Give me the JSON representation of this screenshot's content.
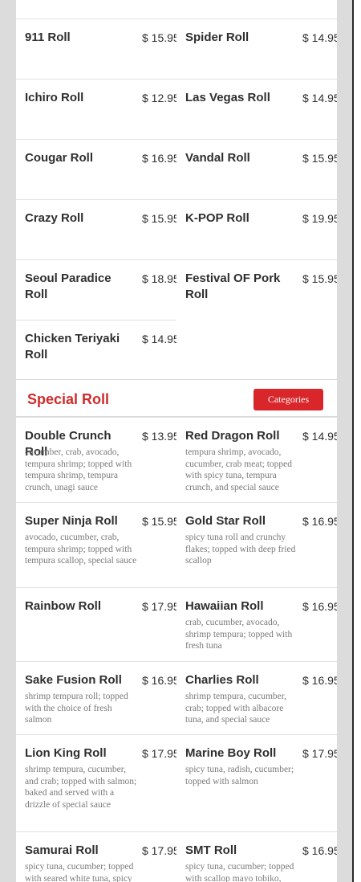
{
  "categories_button": "Categories",
  "top_rows": [
    {
      "left": {
        "name": "911 Roll",
        "price": "$ 15.95"
      },
      "right": {
        "name": "Spider Roll",
        "price": "$ 14.95"
      }
    },
    {
      "left": {
        "name": "Ichiro Roll",
        "price": "$ 12.95"
      },
      "right": {
        "name": "Las Vegas Roll",
        "price": "$ 14.95"
      }
    },
    {
      "left": {
        "name": "Cougar Roll",
        "price": "$ 16.95"
      },
      "right": {
        "name": "Vandal Roll",
        "price": "$ 15.95"
      }
    },
    {
      "left": {
        "name": "Crazy Roll",
        "price": "$ 15.95"
      },
      "right": {
        "name": "K-POP Roll",
        "price": "$ 19.95"
      }
    },
    {
      "left": {
        "name": "Seoul Paradice Roll",
        "price": "$ 18.95"
      },
      "right": {
        "name": "Festival OF Pork Roll",
        "price": "$ 15.95"
      }
    },
    {
      "left": {
        "name": "Chicken Teriyaki Roll",
        "price": "$ 14.95"
      }
    }
  ],
  "special": {
    "title": "Special Roll",
    "rows": [
      {
        "left": {
          "name": "Double Crunch Roll",
          "price": "$ 13.95",
          "desc": "cucumber, crab, avocado, tempura shrimp; topped with tempura shrimp, tempura crunch, unagi sauce"
        },
        "right": {
          "name": "Red Dragon Roll",
          "price": "$ 14.95",
          "desc": "tempura shrimp, avocado, cucumber, crab meat; topped with spicy tuna, tempura crunch, and special sauce"
        }
      },
      {
        "left": {
          "name": "Super Ninja Roll",
          "price": "$ 15.95",
          "desc": "avocado, cucumber, crab, tempura shrimp; topped with tempura scallop, special sauce"
        },
        "right": {
          "name": "Gold Star Roll",
          "price": "$ 16.95",
          "desc": "spicy tuna roll and crunchy flakes; topped with deep fried scallop"
        }
      },
      {
        "left": {
          "name": "Rainbow Roll",
          "price": "$ 17.95",
          "desc": ""
        },
        "right": {
          "name": "Hawaiian Roll",
          "price": "$ 16.95",
          "desc": "crab, cucumber, avocado, shrimp tempura; topped with fresh tuna"
        }
      },
      {
        "left": {
          "name": "Sake Fusion Roll",
          "price": "$ 16.95",
          "desc": "shrimp tempura roll; topped with the choice of fresh salmon"
        },
        "right": {
          "name": "Charlies Roll",
          "price": "$ 16.95",
          "desc": "shrimp tempura, cucumber, crab; topped with albacore tuna, and special sauce"
        }
      },
      {
        "left": {
          "name": "Lion King Roll",
          "price": "$ 17.95",
          "desc": "shrimp tempura, cucumber, and crab; topped with salmon; baked and served with a drizzle of special sauce"
        },
        "right": {
          "name": "Marine Boy Roll",
          "price": "$ 17.95",
          "desc": "spicy tuna, radish, cucumber; topped with salmon"
        }
      },
      {
        "left": {
          "name": "Samurai Roll",
          "price": "$ 17.95",
          "desc": "spicy tuna, cucumber; topped with seared white tuna, spicy"
        },
        "right": {
          "name": "SMT Roll",
          "price": "$ 16.95",
          "desc": "spicy tuna, cucumber; topped with scallop mayo tobiko,"
        }
      }
    ]
  }
}
